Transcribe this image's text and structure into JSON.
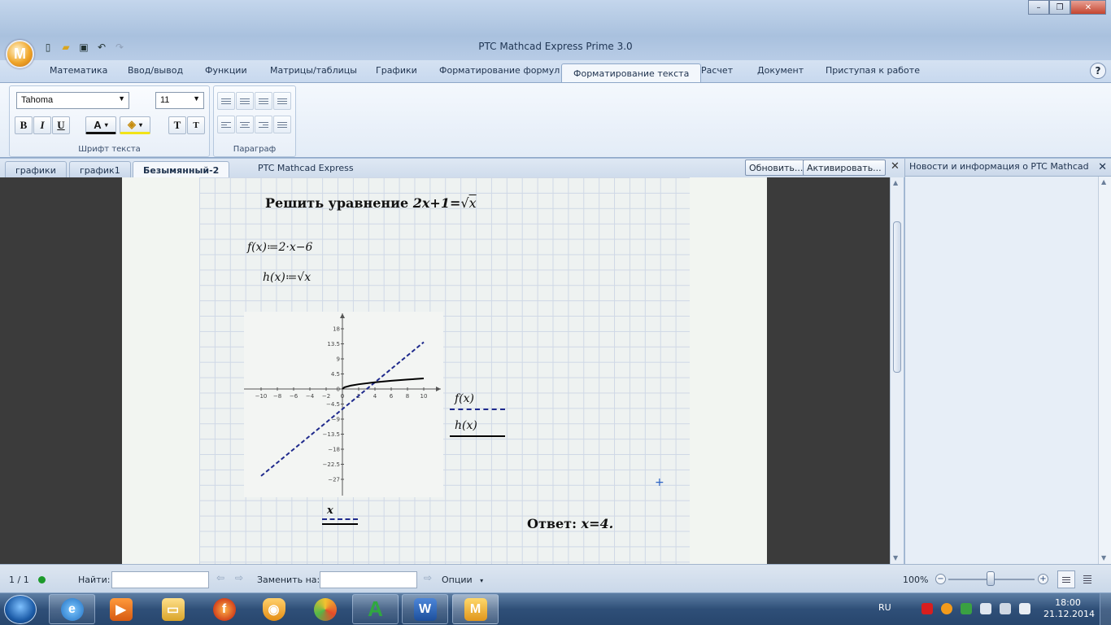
{
  "app": {
    "title": "PTC Mathcad Express Prime 3.0",
    "orb_letter": "M"
  },
  "window_controls": [
    "–",
    "❐",
    "✕"
  ],
  "quick_access": [
    "new-file-icon",
    "open-folder-icon",
    "save-icon",
    "undo-icon",
    "redo-icon"
  ],
  "ribbon": {
    "tabs": [
      "Математика",
      "Ввод/вывод",
      "Функции",
      "Матрицы/таблицы",
      "Графики",
      "Форматирование формул",
      "Форматирование текста",
      "Расчет",
      "Документ",
      "Приступая к работе"
    ],
    "active_tab": "Форматирование текста",
    "help": "?",
    "font_group": {
      "font": "Tahoma",
      "size": "11",
      "bold": "B",
      "italic": "I",
      "underline": "U",
      "font_color": "A",
      "larger": "T",
      "smaller": "T",
      "label": "Шрифт текста"
    },
    "paragraph_group": {
      "label": "Параграф"
    }
  },
  "doc_tabs": {
    "tabs": [
      "графики",
      "график1",
      "Безымянный-2"
    ],
    "active": "Безымянный-2",
    "banner": "PTC Mathcad Express",
    "update_button": "Обновить...",
    "activate_button": "Активировать...",
    "close": "✕"
  },
  "worksheet": {
    "heading_text": "Решить уравнение ",
    "heading_expr": "2x+1=",
    "heading_radical": "√",
    "heading_var": "x",
    "def_f": "f(x)≔2·x−6",
    "def_h": "h(x)≔√x",
    "legend_f": "f(x)",
    "legend_h": "h(x)",
    "x_label": "x",
    "answer_label": "Ответ: ",
    "answer_value": "x=4."
  },
  "chart_data": {
    "type": "line",
    "xlim": [
      -10,
      10
    ],
    "ylim": [
      -27,
      18
    ],
    "x_ticks": [
      -10,
      -8,
      -6,
      -4,
      -2,
      0,
      2,
      4,
      6,
      8,
      10
    ],
    "y_ticks": [
      18,
      13.5,
      9,
      4.5,
      0,
      -4.5,
      -9,
      -13.5,
      -18,
      -22.5,
      -27
    ],
    "x_tick_labels": [
      "−10",
      "−8",
      "−6",
      "−4",
      "−2",
      "0",
      "2",
      "4",
      "6",
      "8",
      "10"
    ],
    "y_tick_labels": [
      "18",
      "13.5",
      "9",
      "4.5",
      "0",
      "−4.5",
      "−9",
      "−13.5",
      "−18",
      "−22.5",
      "−27"
    ],
    "series": [
      {
        "name": "f(x)",
        "style": "dashed",
        "color": "#1f2a8c",
        "x": [
          -10,
          10
        ],
        "y": [
          -26,
          14
        ]
      },
      {
        "name": "h(x)",
        "style": "solid",
        "color": "#000000",
        "x": [
          0,
          0.25,
          1,
          2,
          4,
          6,
          8,
          10
        ],
        "y": [
          0,
          0.5,
          1,
          1.414,
          2,
          2.449,
          2.828,
          3.162
        ]
      }
    ],
    "grid": false
  },
  "news_panel": {
    "title": "Новости и информация о PTC Mathcad",
    "close": "✕"
  },
  "statusbar": {
    "page": "1 / 1",
    "find_label": "Найти:",
    "find_value": "",
    "replace_label": "Заменить на:",
    "replace_value": "",
    "options": "Опции",
    "zoom": "100%"
  },
  "taskbar": {
    "items": [
      "ie-icon",
      "media-player-icon",
      "explorer-icon",
      "firefox-icon",
      "avast-icon",
      "app-icon",
      "autocad-icon",
      "word-icon",
      "mathcad-icon"
    ],
    "language": "RU",
    "time": "18:00",
    "date": "21.12.2014"
  },
  "colors": {
    "f_series": "#1f2a8c",
    "h_series": "#000000",
    "accent": "#2b63c4",
    "status_ok": "#1c9a2b"
  }
}
